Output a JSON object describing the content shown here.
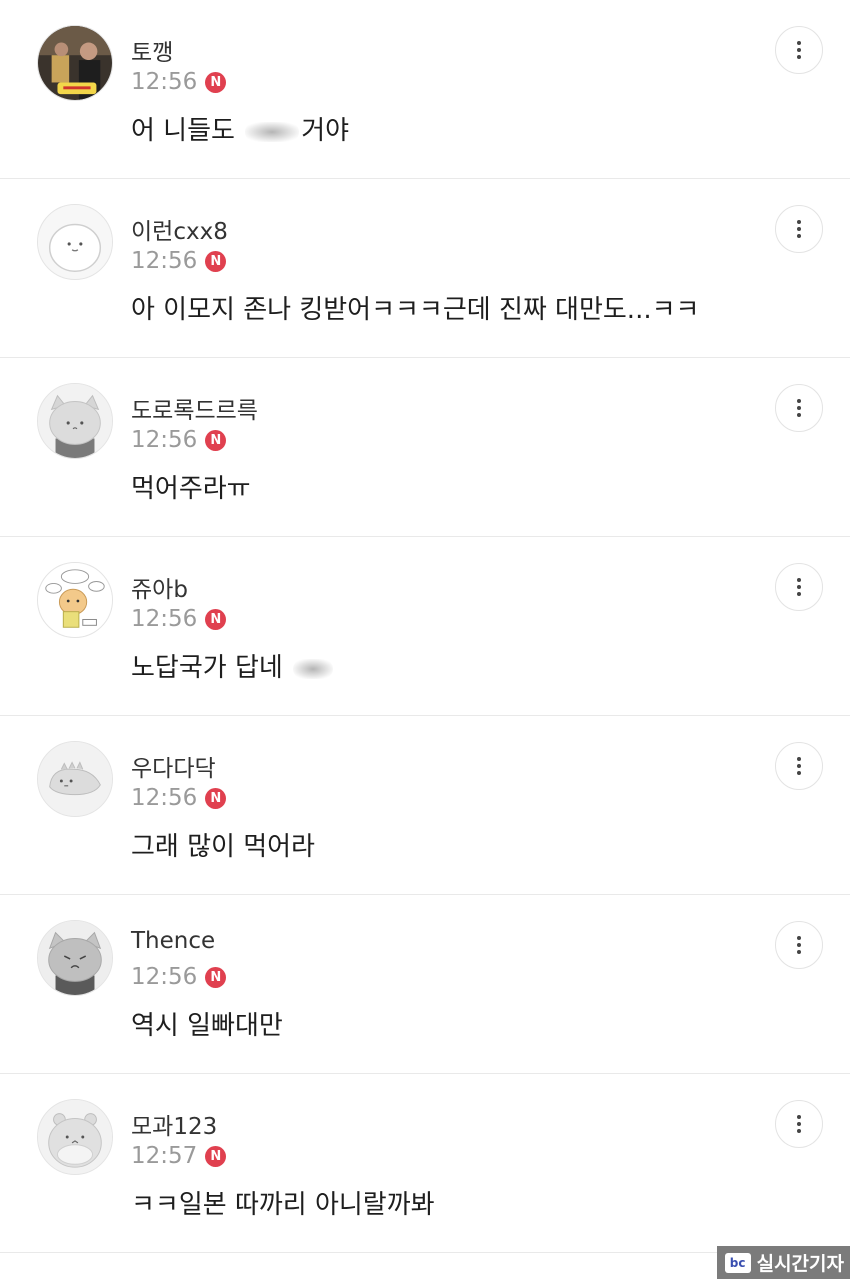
{
  "comments": [
    {
      "nick": "토깽",
      "time": "12:56",
      "badge": "N",
      "text_before": "어 니들도 ",
      "text_after": "거야",
      "blurred": true,
      "avatar": "photo-avatar"
    },
    {
      "nick": "이런cxx8",
      "time": "12:56",
      "badge": "N",
      "text": "아 이모지 존나 킹받어ㅋㅋㅋ근데 진짜 대만도...ㅋㅋ",
      "avatar": "default-face-avatar"
    },
    {
      "nick": "도로록드르륵",
      "time": "12:56",
      "badge": "N",
      "text": "먹어주라ㅠ",
      "avatar": "gray-cat-avatar"
    },
    {
      "nick": "쥬아b",
      "time": "12:56",
      "badge": "N",
      "text_before": "노답국가 답네 ",
      "text_after": "",
      "blurred": true,
      "avatar": "sticker-avatar"
    },
    {
      "nick": "우다다닥",
      "time": "12:56",
      "badge": "N",
      "text": "그래 많이 먹어라",
      "avatar": "dino-avatar"
    },
    {
      "nick": "Thence",
      "time": "12:56",
      "badge": "N",
      "text": "역시 일빠대만",
      "avatar": "angry-cat-avatar"
    },
    {
      "nick": "모과123",
      "time": "12:57",
      "badge": "N",
      "text": "ㅋㅋ일본 따까리 아니랄까봐",
      "avatar": "hamster-avatar"
    }
  ],
  "watermark": {
    "logo": "bc",
    "text": "실시간기자"
  },
  "colors": {
    "badge": "#e0404f",
    "divider": "#e9e9e9",
    "time": "#9a9a9a"
  }
}
